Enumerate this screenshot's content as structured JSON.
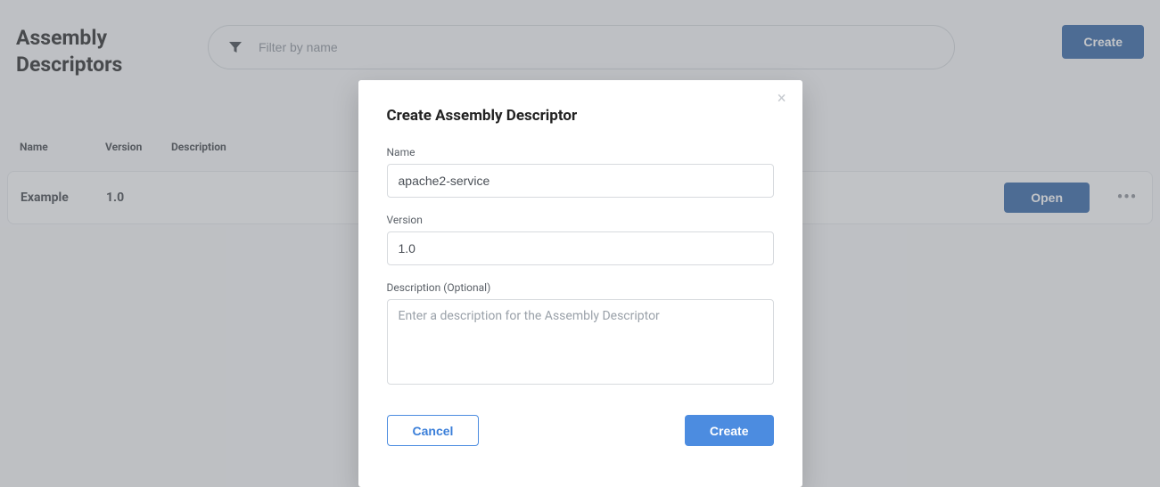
{
  "header": {
    "title_line1": "Assembly",
    "title_line2": "Descriptors",
    "filter_placeholder": "Filter by name",
    "create_label": "Create"
  },
  "columns": {
    "name": "Name",
    "version": "Version",
    "description": "Description"
  },
  "rows": [
    {
      "name": "Example",
      "version": "1.0",
      "description": "",
      "open_label": "Open"
    }
  ],
  "modal": {
    "title": "Create Assembly Descriptor",
    "fields": {
      "name_label": "Name",
      "name_value": "apache2-service",
      "version_label": "Version",
      "version_value": "1.0",
      "description_label": "Description (Optional)",
      "description_value": "",
      "description_placeholder": "Enter a description for the Assembly Descriptor"
    },
    "actions": {
      "cancel": "Cancel",
      "create": "Create"
    }
  }
}
